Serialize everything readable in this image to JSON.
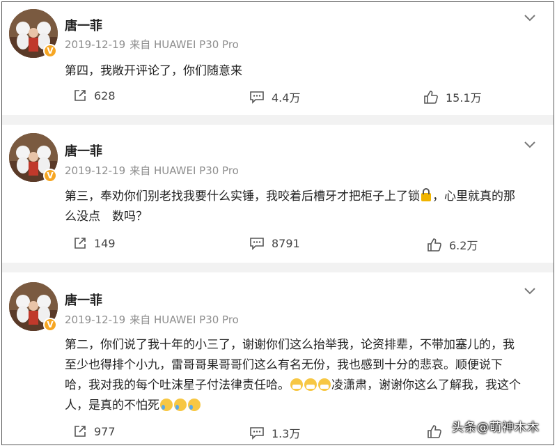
{
  "posts": [
    {
      "user": "唐一菲",
      "date": "2019-12-19",
      "source": "来自 HUAWEI P30 Pro",
      "text_parts": [
        "第四，我敞开评论了，你们随意来"
      ],
      "reposts": "628",
      "comments": "4.4万",
      "likes": "15.1万"
    },
    {
      "user": "唐一菲",
      "date": "2019-12-19",
      "source": "来自 HUAWEI P30 Pro",
      "text_parts": [
        "第三，奉劝你们别老找我要什么实锤，我咬着后槽牙才把柜子上了锁",
        "，心里就真的那么没点　数吗？"
      ],
      "reposts": "149",
      "comments": "8791",
      "likes": "6.2万"
    },
    {
      "user": "唐一菲",
      "date": "2019-12-19",
      "source": "来自 HUAWEI P30 Pro",
      "text_parts": [
        "第二，你们说了我十年的小三了，谢谢你们这么抬举我，论资排辈，不带加塞儿的，我至少也得排个小九，雷哥哥果哥哥们这么有名无份，我也感到十分的悲哀。顺便说下哈，我对我的每个吐沫星子付法律责任哈。",
        "凌潇肃，谢谢你这么了解我，我这个人，是真的不怕死"
      ],
      "reposts": "977",
      "comments": "1.3万",
      "likes": ""
    }
  ],
  "icons": {
    "verified": "verified-badge-icon",
    "repost": "repost-icon",
    "comment": "comment-icon",
    "like": "like-icon",
    "more": "chevron-down-icon",
    "lock": "lock-emoji",
    "mask": "mask-emoji",
    "cry": "crying-laughing-emoji"
  },
  "colors": {
    "badge": "#f6a623",
    "meta": "#8e8e8e",
    "separator": "#f2f2f2"
  },
  "watermark": "头条@萌神木木"
}
